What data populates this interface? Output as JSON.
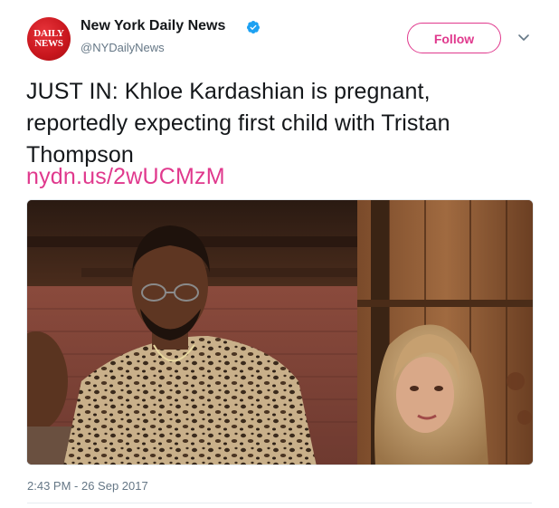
{
  "tweet": {
    "author": {
      "display_name": "New York Daily News",
      "handle": "@NYDailyNews",
      "avatar_logo_line1": "DAILY",
      "avatar_logo_line2": "NEWS",
      "verified": true,
      "verified_icon": "verified-badge-icon"
    },
    "follow_label": "Follow",
    "menu_icon": "chevron-down-icon",
    "text_lines": [
      "JUST IN: Khloe Kardashian is pregnant,",
      "reportedly expecting first child with Tristan",
      "Thompson"
    ],
    "link_text": "nydn.us/2wUCMzM",
    "media": {
      "kind": "photo"
    },
    "timestamp": "2:43 PM - 26 Sep 2017"
  },
  "colors": {
    "accent": "#e0398d",
    "text_primary": "#14171a",
    "text_secondary": "#657786",
    "verified_blue": "#1da1f2",
    "avatar_red": "#c8161d",
    "divider": "#e6ecf0"
  }
}
